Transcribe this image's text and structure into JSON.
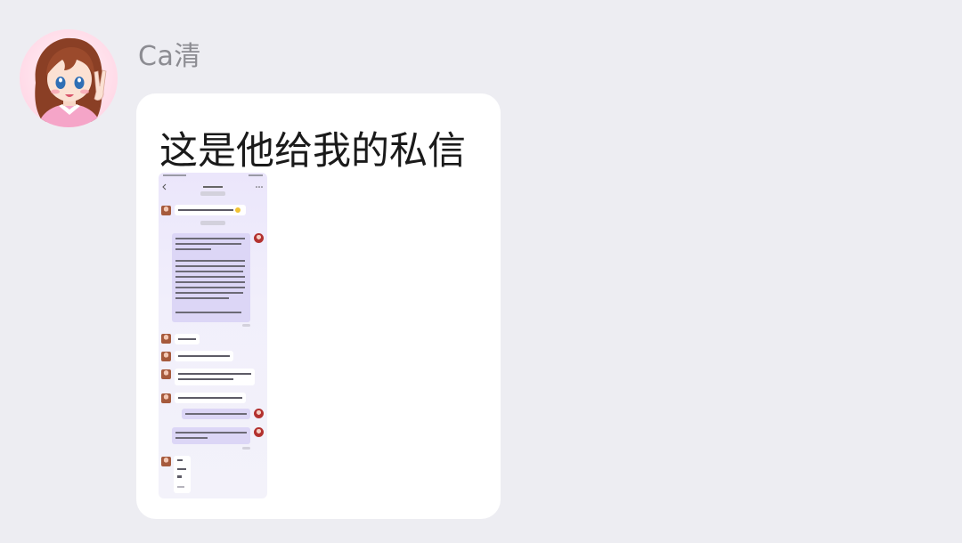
{
  "sender": {
    "name": "Ca清"
  },
  "message": {
    "text": "这是他给我的私信"
  },
  "attachment": {
    "type": "image",
    "icon": "screenshot-thumbnail"
  }
}
